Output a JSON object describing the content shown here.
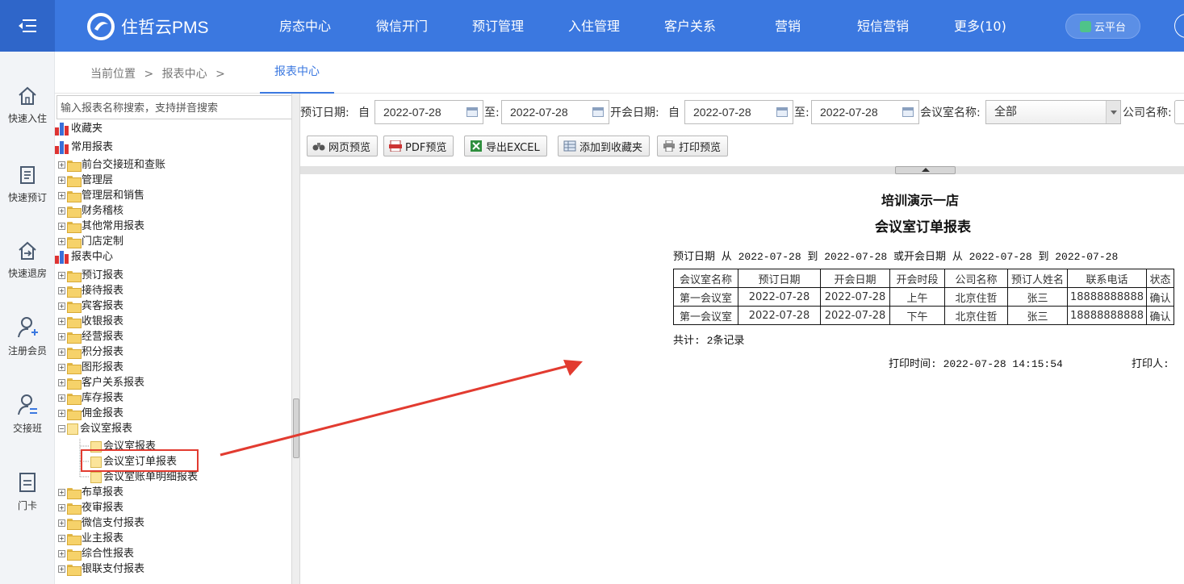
{
  "brand": {
    "name": "住哲云PMS"
  },
  "nav": {
    "items": [
      "房态中心",
      "微信开门",
      "预订管理",
      "入住管理",
      "客户关系",
      "营销",
      "短信营销",
      "更多(10)"
    ],
    "cloud_label": "云平台"
  },
  "quickbar": {
    "items": [
      "快速入住",
      "快速预订",
      "快速退房",
      "注册会员",
      "交接班",
      "门卡"
    ]
  },
  "breadcrumb": {
    "items": [
      "当前位置",
      ">",
      "报表中心",
      ">"
    ],
    "active_tab": "报表中心"
  },
  "tree": {
    "search_placeholder": "输入报表名称搜索，支持拼音搜索",
    "nodes": [
      "收藏夹",
      "常用报表",
      "前台交接班和查账",
      "管理层",
      "管理层和销售",
      "财务稽核",
      "其他常用报表",
      "门店定制",
      "报表中心",
      "预订报表",
      "接待报表",
      "宾客报表",
      "收银报表",
      "经营报表",
      "积分报表",
      "图形报表",
      "客户关系报表",
      "库存报表",
      "佣金报表",
      "会议室报表",
      "会议室报表",
      "会议室订单报表",
      "会议室账单明细报表",
      "布草报表",
      "夜审报表",
      "微信支付报表",
      "业主报表",
      "综合性报表",
      "银联支付报表"
    ]
  },
  "filters": {
    "book_date_label": "预订日期:",
    "from": "自",
    "to": "至:",
    "book_from": "2022-07-28",
    "book_to": "2022-07-28",
    "meet_date_label": "开会日期:",
    "meet_from": "2022-07-28",
    "meet_to": "2022-07-28",
    "room_label": "会议室名称:",
    "room_value": "全部",
    "company_label": "公司名称:"
  },
  "toolbar": {
    "web_preview": "网页预览",
    "pdf_preview": "PDF预览",
    "export_excel": "导出EXCEL",
    "add_favorite": "添加到收藏夹",
    "print_preview": "打印预览"
  },
  "report": {
    "hotel": "培训演示一店",
    "title": "会议室订单报表",
    "condition": "预订日期 从 2022-07-28 到 2022-07-28 或开会日期 从 2022-07-28 到 2022-07-28",
    "columns": [
      "会议室名称",
      "预订日期",
      "开会日期",
      "开会时段",
      "公司名称",
      "预订人姓名",
      "联系电话",
      "状态"
    ],
    "rows": [
      [
        "第一会议室",
        "2022-07-28",
        "2022-07-28",
        "上午",
        "北京住哲",
        "张三",
        "18888888888",
        "确认"
      ],
      [
        "第一会议室",
        "2022-07-28",
        "2022-07-28",
        "下午",
        "北京住哲",
        "张三",
        "18888888888",
        "确认"
      ]
    ],
    "total": "共计: 2条记录",
    "print_time": "打印时间: 2022-07-28 14:15:54",
    "printer": "打印人:"
  },
  "colors": {
    "brand": "#3b78e0",
    "highlight": "#e23b30"
  }
}
